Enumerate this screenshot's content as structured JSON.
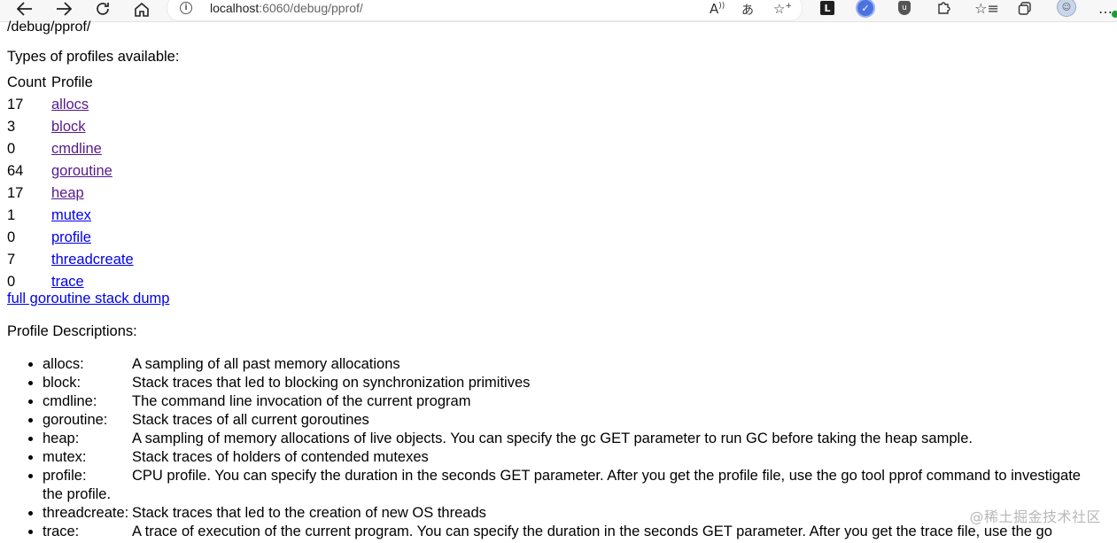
{
  "browser": {
    "url_host": "localhost",
    "url_path": ":6060/debug/pprof/",
    "icons": {
      "back": "arrow-left-icon",
      "forward": "arrow-right-icon",
      "refresh": "refresh-icon",
      "home": "home-icon",
      "info": "info-icon",
      "read_aloud": "read-aloud-icon",
      "translate": "translate-icon",
      "favorite": "add-favorite-icon",
      "extensions": "puzzle-icon",
      "favorites_bar": "favorites-icon",
      "collections": "collections-icon",
      "more": "more-icon"
    },
    "read_aloud_glyph": "A",
    "translate_glyph": "あ",
    "ext_dark_glyph": "L"
  },
  "page": {
    "cut_text": "/debug/pprof/",
    "types_heading": "Types of profiles available:",
    "table": {
      "headers": [
        "Count",
        "Profile"
      ],
      "rows": [
        {
          "count": "17",
          "profile": "allocs",
          "visited": true
        },
        {
          "count": "3",
          "profile": "block",
          "visited": true
        },
        {
          "count": "0",
          "profile": "cmdline",
          "visited": true
        },
        {
          "count": "64",
          "profile": "goroutine",
          "visited": true
        },
        {
          "count": "17",
          "profile": "heap",
          "visited": true
        },
        {
          "count": "1",
          "profile": "mutex",
          "visited": false
        },
        {
          "count": "0",
          "profile": "profile",
          "visited": false
        },
        {
          "count": "7",
          "profile": "threadcreate",
          "visited": false
        },
        {
          "count": "0",
          "profile": "trace",
          "visited": false
        }
      ]
    },
    "full_dump_link": "full goroutine stack dump",
    "desc_heading": "Profile Descriptions:",
    "descriptions": [
      {
        "term": "allocs:",
        "text": "A sampling of all past memory allocations"
      },
      {
        "term": "block:",
        "text": "Stack traces that led to blocking on synchronization primitives"
      },
      {
        "term": "cmdline:",
        "text": "The command line invocation of the current program"
      },
      {
        "term": "goroutine:",
        "text": "Stack traces of all current goroutines"
      },
      {
        "term": "heap:",
        "text": "A sampling of memory allocations of live objects. You can specify the gc GET parameter to run GC before taking the heap sample."
      },
      {
        "term": "mutex:",
        "text": "Stack traces of holders of contended mutexes"
      },
      {
        "term": "profile:",
        "text": "CPU profile. You can specify the duration in the seconds GET parameter. After you get the profile file, use the go tool pprof command to investigate the profile."
      },
      {
        "term": "threadcreate:",
        "text": "Stack traces that led to the creation of new OS threads"
      },
      {
        "term": "trace:",
        "text": "A trace of execution of the current program. You can specify the duration in the seconds GET parameter. After you get the trace file, use the go"
      }
    ],
    "watermark": "@稀土掘金技术社区"
  }
}
